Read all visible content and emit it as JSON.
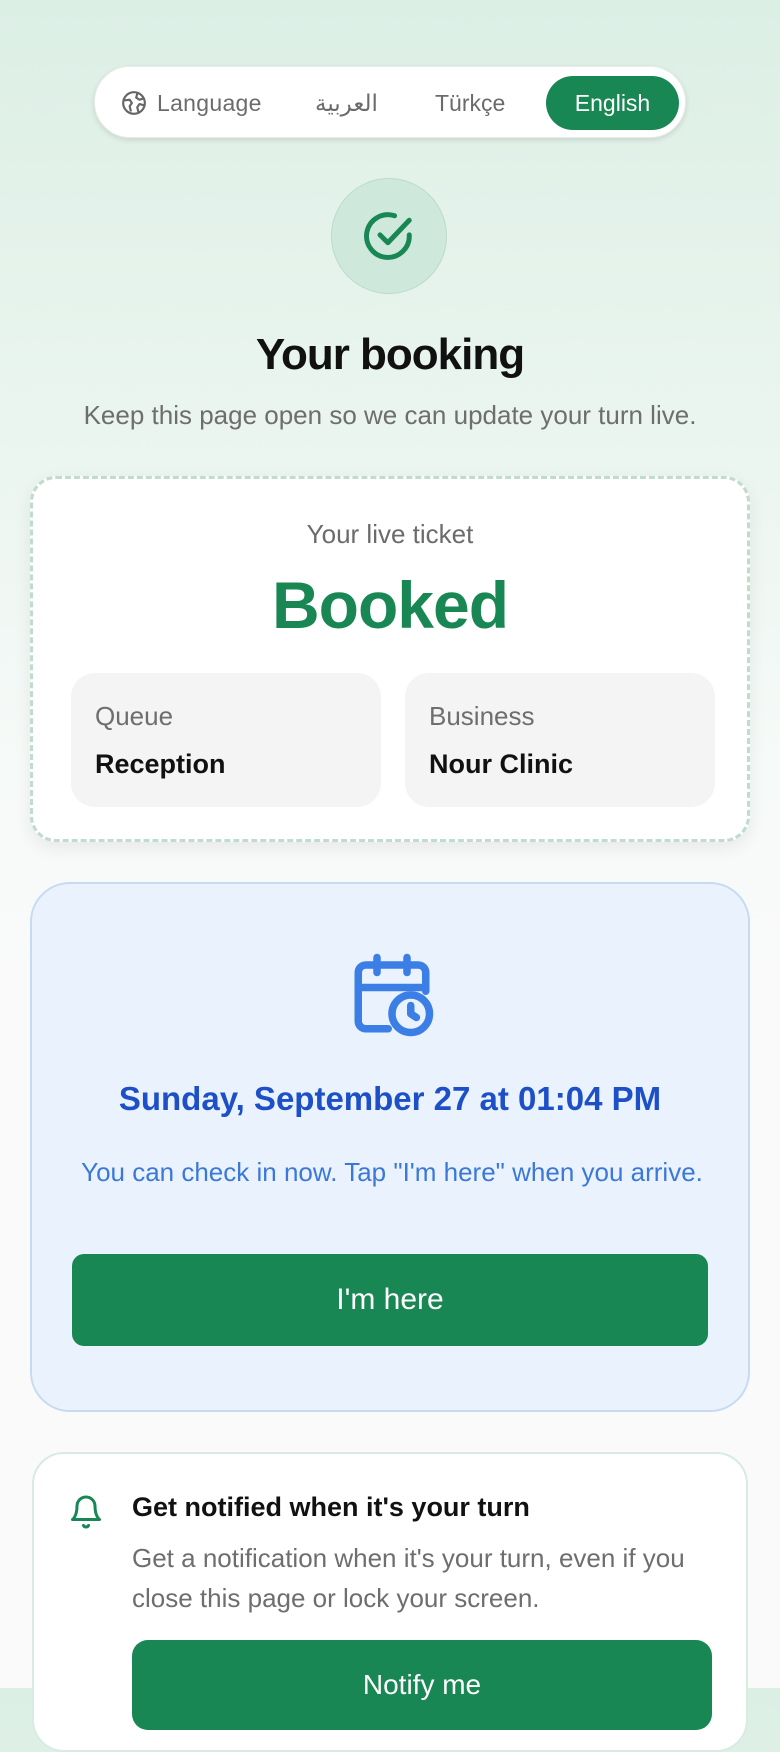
{
  "language_switcher": {
    "label": "Language",
    "options": [
      "العربية",
      "Türkçe",
      "English"
    ],
    "selected": "English",
    "accent_color": "#198754"
  },
  "header": {
    "icon": "check-circle-icon",
    "title": "Your booking",
    "subtitle": "Keep this page open so we can update your turn live."
  },
  "ticket": {
    "caption": "Your live ticket",
    "status": "Booked",
    "queue_label": "Queue",
    "queue_value": "Reception",
    "business_label": "Business",
    "business_value": "Nour Clinic"
  },
  "appointment": {
    "icon": "calendar-clock-icon",
    "datetime": "Sunday, September 27 at 01:04 PM",
    "note": "You can check in now. Tap \"I'm here\" when you arrive.",
    "checkin_button": "I'm here"
  },
  "notifications": {
    "icon": "bell-icon",
    "title": "Get notified when it's your turn",
    "description": "Get a notification when it's your turn, even if you close this page or lock your screen.",
    "button": "Notify me"
  }
}
